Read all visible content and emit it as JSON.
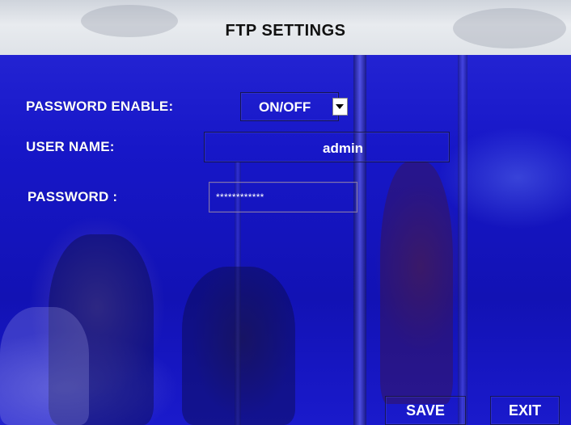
{
  "window": {
    "title": "FTP SETTINGS"
  },
  "form": {
    "password_enable": {
      "label": "PASSWORD ENABLE:",
      "value": "ON/OFF"
    },
    "user_name": {
      "label": "USER NAME:",
      "value": "admin"
    },
    "password": {
      "label": "PASSWORD :",
      "value": "************"
    }
  },
  "buttons": {
    "save_label": "SAVE",
    "exit_label": "EXIT"
  },
  "icons": {
    "dropdown": "chevron-down-icon"
  },
  "colors": {
    "background_tint": "#1717c8",
    "title_bar": "#e3e6ea",
    "text": "#ffffff"
  }
}
